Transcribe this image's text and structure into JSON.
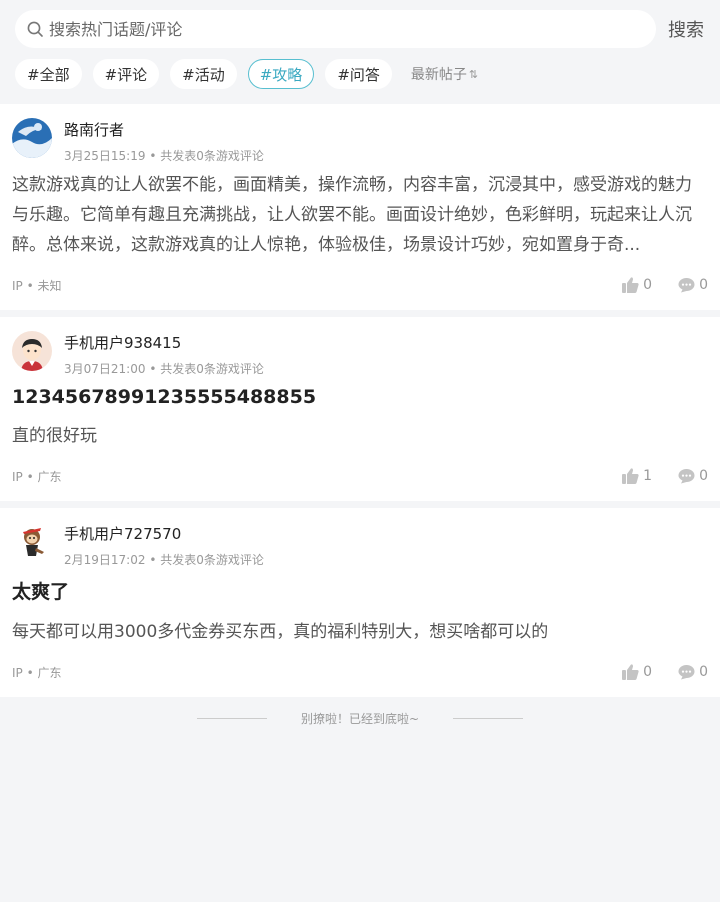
{
  "search": {
    "placeholder": "搜索热门话题/评论",
    "button_label": "搜索"
  },
  "tabs": [
    {
      "label": "#全部",
      "active": false
    },
    {
      "label": "#评论",
      "active": false
    },
    {
      "label": "#活动",
      "active": false
    },
    {
      "label": "#攻略",
      "active": true
    },
    {
      "label": "#问答",
      "active": false
    }
  ],
  "sort_label": "最新帖子",
  "posts": [
    {
      "author": "路南行者",
      "time": "3月25日15:19",
      "meta_extra": "共发表0条游戏评论",
      "title": "",
      "content": "这款游戏真的让人欲罢不能，画面精美，操作流畅，内容丰富，沉浸其中，感受游戏的魅力与乐趣。它简单有趣且充满挑战，让人欲罢不能。画面设计绝妙，色彩鲜明，玩起来让人沉醉。总体来说，这款游戏真的让人惊艳，体验极佳，场景设计巧妙，宛如置身于奇...",
      "ip": "IP • 未知",
      "likes": "0",
      "comments": "0"
    },
    {
      "author": "手机用户938415",
      "time": "3月07日21:00",
      "meta_extra": "共发表0条游戏评论",
      "title": "12345678991235555488855",
      "content": "直的很好玩",
      "ip": "IP • 广东",
      "likes": "1",
      "comments": "0"
    },
    {
      "author": "手机用户727570",
      "time": "2月19日17:02",
      "meta_extra": "共发表0条游戏评论",
      "title": "太爽了",
      "content": "每天都可以用3000多代金券买东西，真的福利特别大，想买啥都可以的",
      "ip": "IP • 广东",
      "likes": "0",
      "comments": "0"
    }
  ],
  "end_text": "别撩啦！已经到底啦~",
  "colors": {
    "accent": "#3aa9c1",
    "background": "#f4f5f7"
  }
}
